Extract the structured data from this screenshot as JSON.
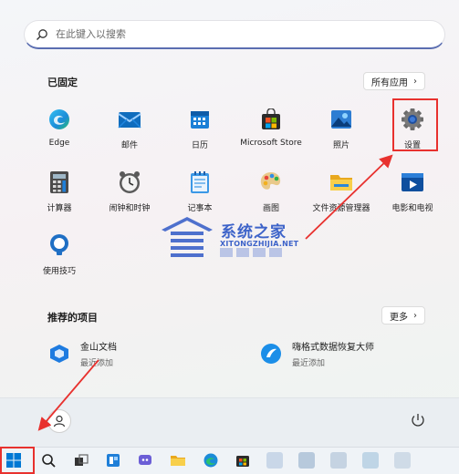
{
  "search": {
    "placeholder": "在此键入以搜索"
  },
  "pinned": {
    "title": "已固定",
    "all_apps_label": "所有应用",
    "apps": [
      {
        "label": "Edge",
        "icon": "edge-icon"
      },
      {
        "label": "邮件",
        "icon": "mail-icon"
      },
      {
        "label": "日历",
        "icon": "calendar-icon"
      },
      {
        "label": "Microsoft Store",
        "icon": "store-icon"
      },
      {
        "label": "照片",
        "icon": "photos-icon"
      },
      {
        "label": "设置",
        "icon": "gear-icon"
      },
      {
        "label": "计算器",
        "icon": "calculator-icon"
      },
      {
        "label": "闹钟和时钟",
        "icon": "clock-icon"
      },
      {
        "label": "记事本",
        "icon": "notepad-icon"
      },
      {
        "label": "画图",
        "icon": "paint-icon"
      },
      {
        "label": "文件资源管理器",
        "icon": "folder-icon"
      },
      {
        "label": "电影和电视",
        "icon": "movies-icon"
      },
      {
        "label": "使用技巧",
        "icon": "tips-icon"
      }
    ]
  },
  "recommended": {
    "title": "推荐的项目",
    "more_label": "更多",
    "items": [
      {
        "name": "金山文档",
        "subtitle": "最近添加",
        "icon": "kdocs-icon"
      },
      {
        "name": "嗨格式数据恢复大师",
        "subtitle": "最近添加",
        "icon": "recovery-icon"
      }
    ]
  },
  "watermark": {
    "title": "系统之家",
    "subtitle": "XITONGZHIJIA.NET"
  },
  "colors": {
    "accent": "#0078d4",
    "highlight": "#e8312e",
    "watermark": "#3d63c9"
  }
}
